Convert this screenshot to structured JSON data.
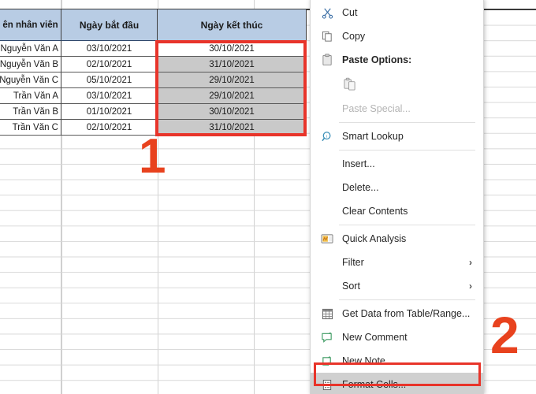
{
  "spreadsheet": {
    "table": {
      "headers": [
        "ên nhân viên",
        "Ngày bắt đầu",
        "Ngày kết thúc"
      ],
      "rows": [
        {
          "name": "Nguyễn Văn A",
          "start": "03/10/2021",
          "end": "30/10/2021",
          "state": "active"
        },
        {
          "name": "Nguyễn Văn B",
          "start": "02/10/2021",
          "end": "31/10/2021",
          "state": "selected"
        },
        {
          "name": "Nguyễn Văn C",
          "start": "05/10/2021",
          "end": "29/10/2021",
          "state": "selected"
        },
        {
          "name": "Trần Văn A",
          "start": "03/10/2021",
          "end": "29/10/2021",
          "state": "selected"
        },
        {
          "name": "Trần Văn B",
          "start": "01/10/2021",
          "end": "30/10/2021",
          "state": "selected"
        },
        {
          "name": "Trần Văn C",
          "start": "02/10/2021",
          "end": "31/10/2021",
          "state": "selected"
        }
      ]
    }
  },
  "annotations": {
    "step_one": "1",
    "step_two": "2",
    "accent_color": "#e8421e",
    "box_color": "#e8342a"
  },
  "context_menu": {
    "items": [
      {
        "id": "cut",
        "label": "Cut",
        "icon": "scissors-icon",
        "type": "item"
      },
      {
        "id": "copy",
        "label": "Copy",
        "icon": "copy-icon",
        "type": "item"
      },
      {
        "id": "paste-options",
        "label": "Paste Options:",
        "icon": "clipboard-icon",
        "type": "header"
      },
      {
        "id": "paste-thumb",
        "label": "",
        "icon": "paste-thumb-icon",
        "type": "thumb"
      },
      {
        "id": "paste-special",
        "label": "Paste Special...",
        "icon": "",
        "type": "disabled"
      },
      {
        "id": "separator-1",
        "label": "",
        "icon": "",
        "type": "separator"
      },
      {
        "id": "smart-lookup",
        "label": "Smart Lookup",
        "icon": "magnifier-icon",
        "type": "item"
      },
      {
        "id": "separator-2",
        "label": "",
        "icon": "",
        "type": "separator"
      },
      {
        "id": "insert",
        "label": "Insert...",
        "icon": "",
        "type": "item"
      },
      {
        "id": "delete",
        "label": "Delete...",
        "icon": "",
        "type": "item"
      },
      {
        "id": "clear-contents",
        "label": "Clear Contents",
        "icon": "",
        "type": "item"
      },
      {
        "id": "separator-3",
        "label": "",
        "icon": "",
        "type": "separator"
      },
      {
        "id": "quick-analysis",
        "label": "Quick Analysis",
        "icon": "quick-analysis-icon",
        "type": "item"
      },
      {
        "id": "filter",
        "label": "Filter",
        "icon": "",
        "type": "submenu"
      },
      {
        "id": "sort",
        "label": "Sort",
        "icon": "",
        "type": "submenu"
      },
      {
        "id": "separator-4",
        "label": "",
        "icon": "",
        "type": "separator"
      },
      {
        "id": "get-data",
        "label": "Get Data from Table/Range...",
        "icon": "table-icon",
        "type": "item"
      },
      {
        "id": "new-comment",
        "label": "New Comment",
        "icon": "comment-icon",
        "type": "item"
      },
      {
        "id": "new-note",
        "label": "New Note",
        "icon": "note-icon",
        "type": "item"
      },
      {
        "id": "format-cells",
        "label": "Format Cells...",
        "icon": "format-cells-icon",
        "type": "highlight"
      }
    ],
    "submenu_arrow": "›"
  }
}
